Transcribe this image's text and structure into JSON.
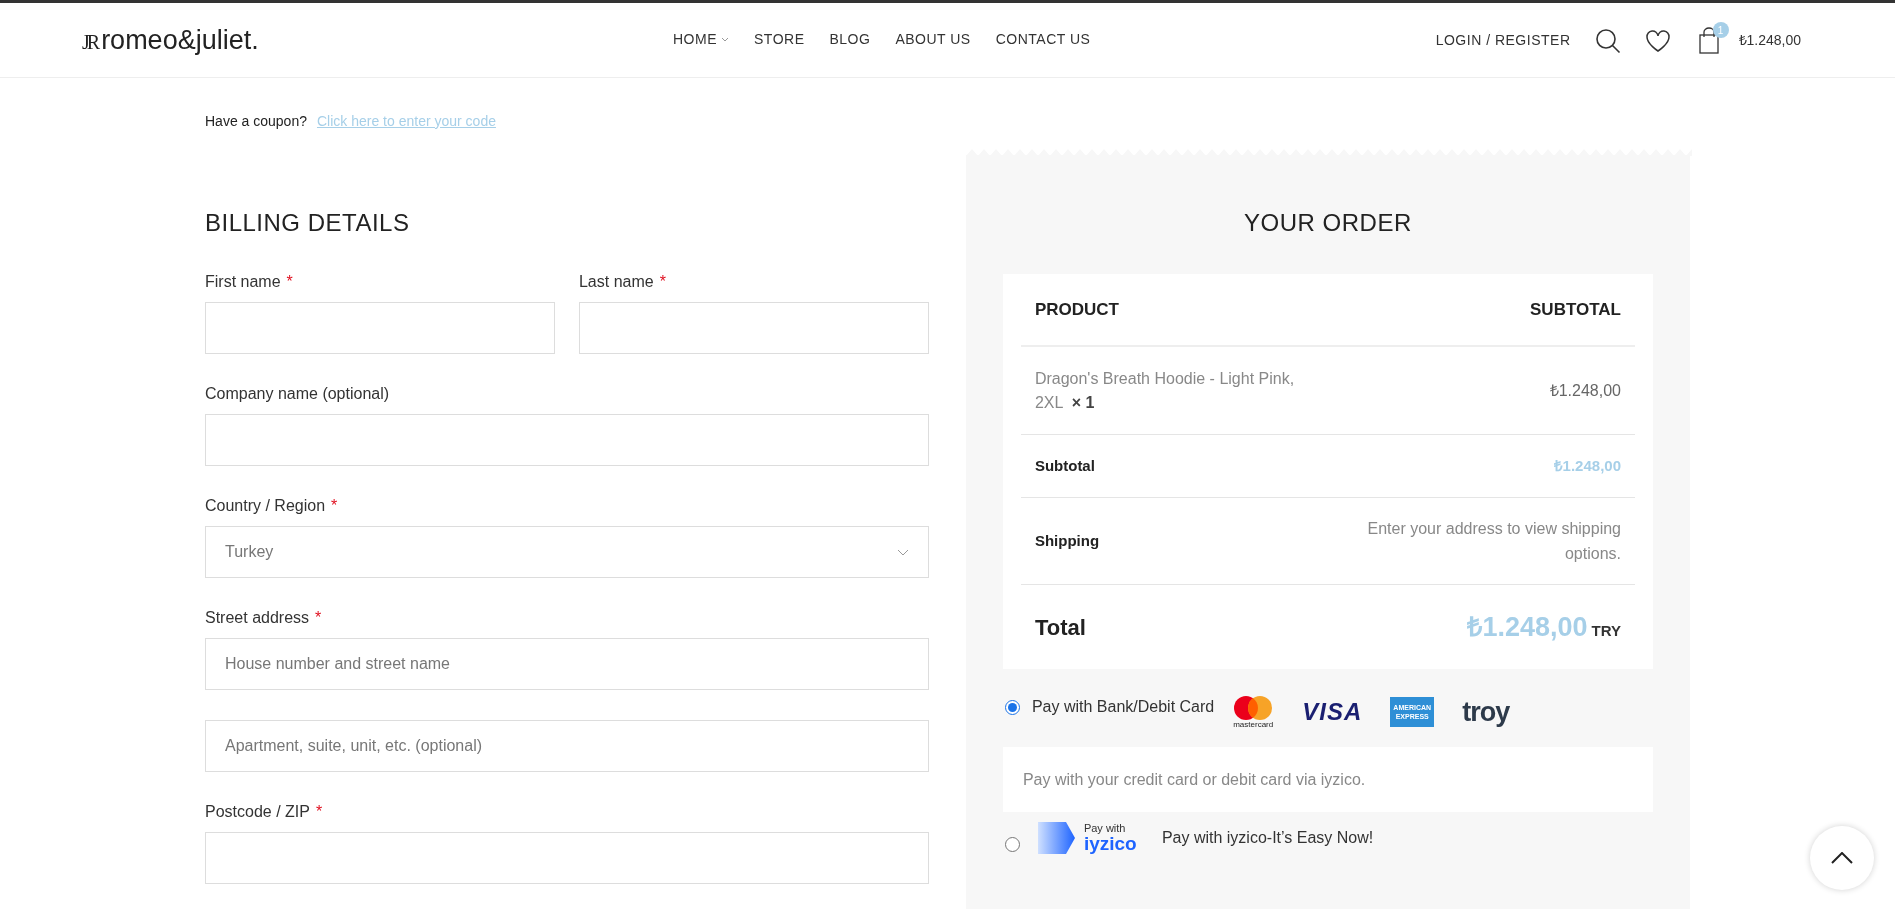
{
  "header": {
    "logo_mark": "JR",
    "logo_text": "romeo&juliet.",
    "nav": [
      {
        "label": "HOME",
        "dropdown": true
      },
      {
        "label": "STORE",
        "dropdown": false
      },
      {
        "label": "BLOG",
        "dropdown": false
      },
      {
        "label": "ABOUT US",
        "dropdown": false
      },
      {
        "label": "CONTACT US",
        "dropdown": false
      }
    ],
    "login": "LOGIN / REGISTER",
    "cart_count": "1",
    "cart_total": "₺1.248,00"
  },
  "coupon": {
    "text": "Have a coupon?",
    "link": "Click here to enter your code"
  },
  "billing": {
    "title": "BILLING DETAILS",
    "rows": [
      [
        {
          "kind": "text",
          "label": "First name",
          "required_mark": "*"
        },
        {
          "kind": "text",
          "label": "Last name",
          "required_mark": "*"
        }
      ],
      [
        {
          "kind": "text",
          "label": "Company name (optional)"
        }
      ],
      [
        {
          "kind": "select",
          "label": "Country / Region",
          "required_mark": "*",
          "value": "Turkey"
        }
      ],
      [
        {
          "kind": "text",
          "label": "Street address",
          "required_mark": "*",
          "placeholder": "House number and street name"
        }
      ],
      [
        {
          "kind": "text",
          "placeholder": "Apartment, suite, unit, etc. (optional)"
        }
      ],
      [
        {
          "kind": "text",
          "label": "Postcode / ZIP",
          "required_mark": "*"
        }
      ]
    ]
  },
  "order": {
    "title": "YOUR ORDER",
    "columns": [
      "PRODUCT",
      "SUBTOTAL"
    ],
    "item": {
      "name": "Dragon's Breath Hoodie - Light Pink, 2XL",
      "qty": "× 1",
      "price": "₺1.248,00"
    },
    "subtotal": {
      "label": "Subtotal",
      "value": "₺1.248,00"
    },
    "shipping": {
      "label": "Shipping",
      "value": "Enter your address to view shipping options."
    },
    "total": {
      "label": "Total",
      "value": "₺1.248,00",
      "currency": "TRY"
    }
  },
  "payment": [
    {
      "kind": "cards",
      "label": "Pay with Bank/Debit Card",
      "selected": true,
      "logos": [
        "mastercard",
        "VISA",
        "AMERICAN EXPRESS",
        "troy"
      ],
      "description": "Pay with your credit card or debit card via iyzico."
    },
    {
      "kind": "iyzico",
      "label": "Pay with iyzico-It’s Easy Now!",
      "selected": false,
      "logos": [
        "Pay with",
        "iyzico"
      ]
    }
  ]
}
